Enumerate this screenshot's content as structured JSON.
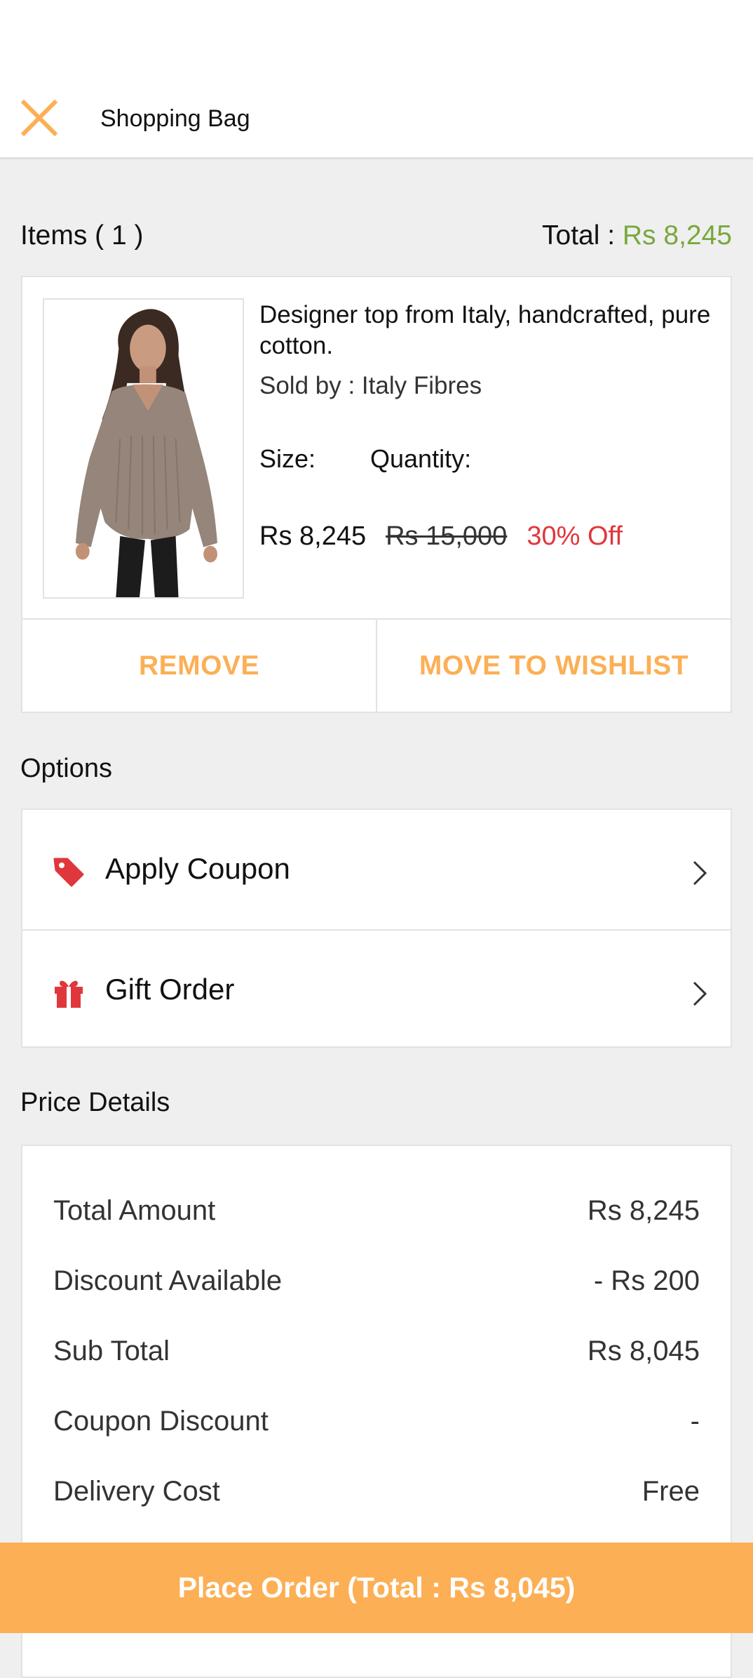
{
  "header": {
    "title": "Shopping Bag"
  },
  "bag": {
    "items_label": "Items ( 1 )",
    "total_label": "Total : ",
    "total_value": "Rs 8,245"
  },
  "item": {
    "name": "Designer top from Italy, handcrafted, pure cotton.",
    "sold_by": "Sold by : Italy Fibres",
    "size_label": "Size:",
    "quantity_label": "Quantity:",
    "price": "Rs 8,245",
    "mrp": "Rs 15,000",
    "discount": "30% Off",
    "remove_label": "REMOVE",
    "wishlist_label": "MOVE TO WISHLIST"
  },
  "options": {
    "title": "Options",
    "items": [
      {
        "label": "Apply Coupon",
        "icon": "tag-icon"
      },
      {
        "label": "Gift Order",
        "icon": "gift-icon"
      }
    ]
  },
  "price_details": {
    "title": "Price Details",
    "rows": [
      {
        "label": "Total Amount",
        "value": "Rs 8,245"
      },
      {
        "label": "Discount Available",
        "value": "- Rs 200"
      },
      {
        "label": "Sub Total",
        "value": "Rs 8,045"
      },
      {
        "label": "Coupon Discount",
        "value": "-"
      },
      {
        "label": "Delivery Cost",
        "value": "Free"
      }
    ]
  },
  "footer": {
    "place_order_label": "Place Order (Total : Rs 8,045)"
  },
  "colors": {
    "accent": "#fcaf55",
    "total_green": "#79a83c",
    "discount_red": "#e0373c",
    "icon_red": "#e0373c"
  }
}
